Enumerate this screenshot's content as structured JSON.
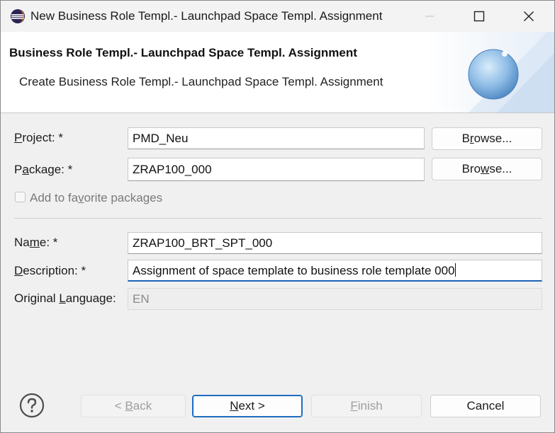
{
  "window": {
    "title": "New Business Role Templ.- Launchpad Space Templ. Assignment"
  },
  "header": {
    "title": "Business Role Templ.- Launchpad Space Templ. Assignment",
    "description": "Create Business Role Templ.- Launchpad Space Templ. Assignment"
  },
  "form": {
    "project": {
      "label_pre": "",
      "label_mn": "P",
      "label_post": "roject: *",
      "value": "PMD_Neu"
    },
    "package": {
      "label_pre": "P",
      "label_mn": "a",
      "label_post": "ckage: *",
      "value": "ZRAP100_000"
    },
    "browse": {
      "pre": "B",
      "mn1": "r",
      "post1": "owse...",
      "pre2": "Bro",
      "mn2": "w",
      "post2": "se..."
    },
    "favorite": {
      "pre": "Add to fa",
      "mn": "v",
      "post": "orite packages",
      "checked": false
    },
    "name": {
      "label_pre": "Na",
      "label_mn": "m",
      "label_post": "e: *",
      "value": "ZRAP100_BRT_SPT_000"
    },
    "description": {
      "label_pre": "",
      "label_mn": "D",
      "label_post": "escription: *",
      "value": "Assignment of space template to business role template 000"
    },
    "language": {
      "label_pre": "Original ",
      "label_mn": "L",
      "label_post": "anguage:",
      "value": "EN"
    }
  },
  "footer": {
    "back": {
      "pre": "< ",
      "mn": "B",
      "post": "ack"
    },
    "next": {
      "pre": "",
      "mn": "N",
      "post": "ext >"
    },
    "finish": {
      "pre": "",
      "mn": "F",
      "post": "inish"
    },
    "cancel": "Cancel"
  }
}
